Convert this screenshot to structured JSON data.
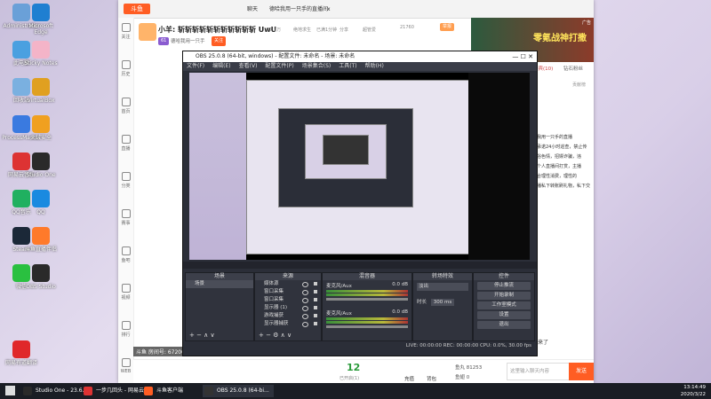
{
  "desktop": {
    "icons": [
      {
        "label": "Administrator",
        "color": "#6aa0d8"
      },
      {
        "label": "Microsoft Edge",
        "color": "#1f7fd1"
      },
      {
        "label": "此电脑",
        "color": "#4aa0e0"
      },
      {
        "label": "Sticky Notes",
        "color": "#f4b4c8"
      },
      {
        "label": "回收站",
        "color": "#7ab0e0"
      },
      {
        "label": "VirtualBox",
        "color": "#e0a020"
      },
      {
        "label": "ProcessMaster",
        "color": "#3a7ae0"
      },
      {
        "label": "火绒安全",
        "color": "#f0a020"
      },
      {
        "label": "网易云音乐",
        "color": "#d33"
      },
      {
        "label": "Studio One",
        "color": "#2a2a2a"
      },
      {
        "label": "QQ音乐",
        "color": "#20b060"
      },
      {
        "label": "QQ",
        "color": "#1a8ae0"
      },
      {
        "label": "Steam",
        "color": "#1b2838"
      },
      {
        "label": "斗鱼直播伴侣",
        "color": "#ff7a2a"
      },
      {
        "label": "微信",
        "color": "#2ac040"
      },
      {
        "label": "OBS Studio",
        "color": "#2a2a2a"
      },
      {
        "label": "网易有道翻译",
        "color": "#e0282a"
      }
    ]
  },
  "browser": {
    "brand": "斗鱼",
    "tabs": [
      "聊天",
      "德哈我用一只手的直播间",
      "x"
    ],
    "room_title": "小羊: 斩斩斩斩斩斩斩斩斩斩斩 UwU",
    "follow_count": "77.2万",
    "tags": [
      "绝地求生",
      "已满1分钟",
      "分享",
      "超管爱"
    ],
    "level_badge": "61",
    "anchor_name": "德哈我用一只手",
    "follow_button": "关注",
    "hot_value": "21760",
    "report_button": "举报",
    "sidebar": [
      "关注",
      "历史",
      "首页",
      "直播",
      "分类",
      "赛事",
      "鱼吧",
      "视频",
      "排行",
      "WEB"
    ],
    "ad": {
      "label": "广告",
      "text": "零氪战神打撒"
    },
    "ranking_tabs": [
      "贵宾(10)",
      "钻石粉丝"
    ],
    "rank_note": "贡献榜",
    "chat_text": [
      "德哈我用一只手的直播",
      "主播承诺24小时巡查，禁止传",
      "播低俗色情，招嫖诈骗，违",
      "信用个人直播间打赏，主播",
      "正常合理性消费，理性的",
      "与主播私下转账刷礼物，私下交易"
    ],
    "room_number": "斗鱼 房间号: 6720032",
    "gift_bar": {
      "count": "12",
      "count_label": "已开启(1)",
      "tail": "来了",
      "fish_balls": "鱼丸 81253",
      "fish_label": "鱼翅 0",
      "recharge": "充值",
      "backpack": "背包",
      "input_placeholder": "这里输入聊天内容",
      "send": "发送"
    }
  },
  "obs": {
    "title": "OBS 25.0.8 (64-bit, windows) - 配置文件: 未命名 - 场景: 未命名",
    "menu": [
      "文件(F)",
      "编辑(E)",
      "查看(V)",
      "配置文件(P)",
      "场景集合(S)",
      "工具(T)",
      "帮助(H)"
    ],
    "docks": {
      "scenes": {
        "header": "场景",
        "items": [
          "场景"
        ]
      },
      "sources": {
        "header": "来源",
        "items": [
          "媒体源",
          "窗口采集",
          "窗口采集",
          "显示器 (1)",
          "游戏捕获",
          "显示器捕获"
        ]
      },
      "mixer": {
        "header": "混音器",
        "tracks": [
          {
            "name": "麦克风/Aux",
            "db": "0.0 dB"
          },
          {
            "name": "麦克风/Aux",
            "db": "0.0 dB"
          }
        ]
      },
      "transitions": {
        "header": "转场特效",
        "type": "淡出",
        "duration_label": "时长",
        "duration": "300 ms"
      },
      "controls": {
        "header": "控件",
        "buttons": [
          "停止推流",
          "开始录制",
          "工作室模式",
          "设置",
          "退出"
        ]
      }
    },
    "status": "LIVE: 00:00:00   REC: 00:00:00   CPU: 0.0%, 30.00 fps"
  },
  "taskbar": {
    "items": [
      {
        "label": "Studio One - 23.6...",
        "color": "#2a2a2a"
      },
      {
        "label": "一步几回头 - 网易云",
        "color": "#d33"
      },
      {
        "label": "斗鱼客户端",
        "color": "#ff5d23"
      },
      {
        "label": "OBS 25.0.8 (64-bi...",
        "color": "#333"
      }
    ],
    "time": "13:14:49",
    "date": "2020/3/22"
  }
}
